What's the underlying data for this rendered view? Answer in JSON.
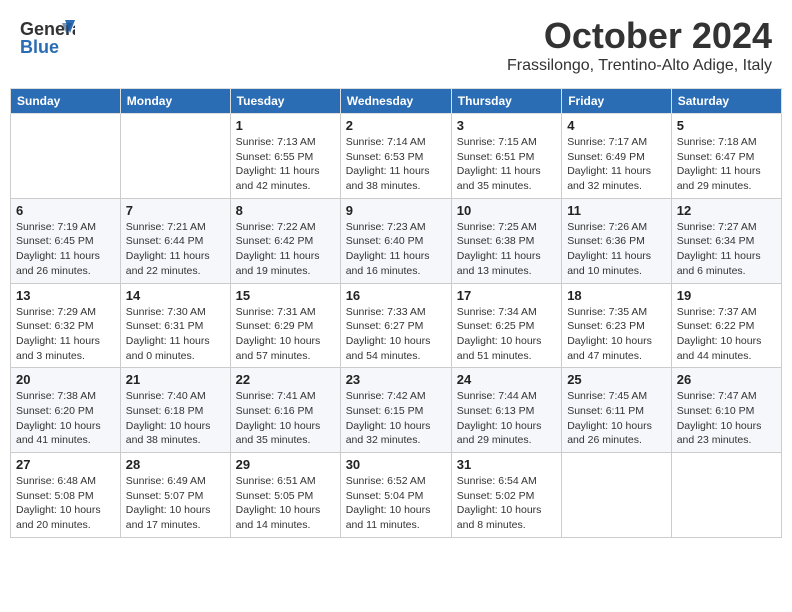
{
  "header": {
    "logo_line1": "General",
    "logo_line2": "Blue",
    "month": "October 2024",
    "location": "Frassilongo, Trentino-Alto Adige, Italy"
  },
  "columns": [
    "Sunday",
    "Monday",
    "Tuesday",
    "Wednesday",
    "Thursday",
    "Friday",
    "Saturday"
  ],
  "weeks": [
    [
      {
        "day": "",
        "info": ""
      },
      {
        "day": "",
        "info": ""
      },
      {
        "day": "1",
        "info": "Sunrise: 7:13 AM\nSunset: 6:55 PM\nDaylight: 11 hours and 42 minutes."
      },
      {
        "day": "2",
        "info": "Sunrise: 7:14 AM\nSunset: 6:53 PM\nDaylight: 11 hours and 38 minutes."
      },
      {
        "day": "3",
        "info": "Sunrise: 7:15 AM\nSunset: 6:51 PM\nDaylight: 11 hours and 35 minutes."
      },
      {
        "day": "4",
        "info": "Sunrise: 7:17 AM\nSunset: 6:49 PM\nDaylight: 11 hours and 32 minutes."
      },
      {
        "day": "5",
        "info": "Sunrise: 7:18 AM\nSunset: 6:47 PM\nDaylight: 11 hours and 29 minutes."
      }
    ],
    [
      {
        "day": "6",
        "info": "Sunrise: 7:19 AM\nSunset: 6:45 PM\nDaylight: 11 hours and 26 minutes."
      },
      {
        "day": "7",
        "info": "Sunrise: 7:21 AM\nSunset: 6:44 PM\nDaylight: 11 hours and 22 minutes."
      },
      {
        "day": "8",
        "info": "Sunrise: 7:22 AM\nSunset: 6:42 PM\nDaylight: 11 hours and 19 minutes."
      },
      {
        "day": "9",
        "info": "Sunrise: 7:23 AM\nSunset: 6:40 PM\nDaylight: 11 hours and 16 minutes."
      },
      {
        "day": "10",
        "info": "Sunrise: 7:25 AM\nSunset: 6:38 PM\nDaylight: 11 hours and 13 minutes."
      },
      {
        "day": "11",
        "info": "Sunrise: 7:26 AM\nSunset: 6:36 PM\nDaylight: 11 hours and 10 minutes."
      },
      {
        "day": "12",
        "info": "Sunrise: 7:27 AM\nSunset: 6:34 PM\nDaylight: 11 hours and 6 minutes."
      }
    ],
    [
      {
        "day": "13",
        "info": "Sunrise: 7:29 AM\nSunset: 6:32 PM\nDaylight: 11 hours and 3 minutes."
      },
      {
        "day": "14",
        "info": "Sunrise: 7:30 AM\nSunset: 6:31 PM\nDaylight: 11 hours and 0 minutes."
      },
      {
        "day": "15",
        "info": "Sunrise: 7:31 AM\nSunset: 6:29 PM\nDaylight: 10 hours and 57 minutes."
      },
      {
        "day": "16",
        "info": "Sunrise: 7:33 AM\nSunset: 6:27 PM\nDaylight: 10 hours and 54 minutes."
      },
      {
        "day": "17",
        "info": "Sunrise: 7:34 AM\nSunset: 6:25 PM\nDaylight: 10 hours and 51 minutes."
      },
      {
        "day": "18",
        "info": "Sunrise: 7:35 AM\nSunset: 6:23 PM\nDaylight: 10 hours and 47 minutes."
      },
      {
        "day": "19",
        "info": "Sunrise: 7:37 AM\nSunset: 6:22 PM\nDaylight: 10 hours and 44 minutes."
      }
    ],
    [
      {
        "day": "20",
        "info": "Sunrise: 7:38 AM\nSunset: 6:20 PM\nDaylight: 10 hours and 41 minutes."
      },
      {
        "day": "21",
        "info": "Sunrise: 7:40 AM\nSunset: 6:18 PM\nDaylight: 10 hours and 38 minutes."
      },
      {
        "day": "22",
        "info": "Sunrise: 7:41 AM\nSunset: 6:16 PM\nDaylight: 10 hours and 35 minutes."
      },
      {
        "day": "23",
        "info": "Sunrise: 7:42 AM\nSunset: 6:15 PM\nDaylight: 10 hours and 32 minutes."
      },
      {
        "day": "24",
        "info": "Sunrise: 7:44 AM\nSunset: 6:13 PM\nDaylight: 10 hours and 29 minutes."
      },
      {
        "day": "25",
        "info": "Sunrise: 7:45 AM\nSunset: 6:11 PM\nDaylight: 10 hours and 26 minutes."
      },
      {
        "day": "26",
        "info": "Sunrise: 7:47 AM\nSunset: 6:10 PM\nDaylight: 10 hours and 23 minutes."
      }
    ],
    [
      {
        "day": "27",
        "info": "Sunrise: 6:48 AM\nSunset: 5:08 PM\nDaylight: 10 hours and 20 minutes."
      },
      {
        "day": "28",
        "info": "Sunrise: 6:49 AM\nSunset: 5:07 PM\nDaylight: 10 hours and 17 minutes."
      },
      {
        "day": "29",
        "info": "Sunrise: 6:51 AM\nSunset: 5:05 PM\nDaylight: 10 hours and 14 minutes."
      },
      {
        "day": "30",
        "info": "Sunrise: 6:52 AM\nSunset: 5:04 PM\nDaylight: 10 hours and 11 minutes."
      },
      {
        "day": "31",
        "info": "Sunrise: 6:54 AM\nSunset: 5:02 PM\nDaylight: 10 hours and 8 minutes."
      },
      {
        "day": "",
        "info": ""
      },
      {
        "day": "",
        "info": ""
      }
    ]
  ]
}
